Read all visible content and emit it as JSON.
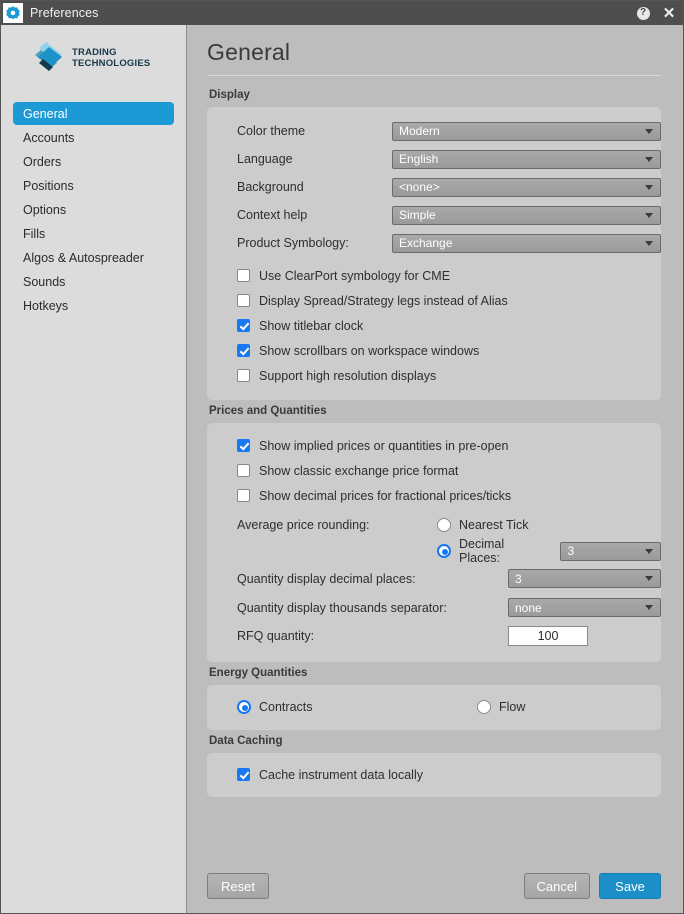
{
  "titlebar": {
    "title": "Preferences",
    "app_icon": "gear-icon",
    "help_label": "?",
    "close_label": "✕"
  },
  "sidebar": {
    "logo": {
      "line1": "TRADING",
      "line2": "TECHNOLOGIES",
      "colors": [
        "#8ed4e8",
        "#4a9fb5",
        "#1c77a8",
        "#123a4d"
      ]
    },
    "items": [
      {
        "label": "General",
        "selected": true
      },
      {
        "label": "Accounts",
        "selected": false
      },
      {
        "label": "Orders",
        "selected": false
      },
      {
        "label": "Positions",
        "selected": false
      },
      {
        "label": "Options",
        "selected": false
      },
      {
        "label": "Fills",
        "selected": false
      },
      {
        "label": "Algos & Autospreader",
        "selected": false
      },
      {
        "label": "Sounds",
        "selected": false
      },
      {
        "label": "Hotkeys",
        "selected": false
      }
    ]
  },
  "main": {
    "page_title": "General",
    "display": {
      "header": "Display",
      "fields": [
        {
          "label": "Color theme",
          "value": "Modern"
        },
        {
          "label": "Language",
          "value": "English"
        },
        {
          "label": "Background",
          "value": "<none>"
        },
        {
          "label": "Context help",
          "value": "Simple"
        },
        {
          "label": "Product Symbology:",
          "value": "Exchange"
        }
      ],
      "checkboxes": [
        {
          "label": "Use ClearPort symbology for CME",
          "checked": false
        },
        {
          "label": "Display Spread/Strategy legs instead of Alias",
          "checked": false
        },
        {
          "label": "Show titlebar clock",
          "checked": true
        },
        {
          "label": "Show scrollbars on workspace windows",
          "checked": true
        },
        {
          "label": "Support high resolution displays",
          "checked": false
        }
      ]
    },
    "prices_quantities": {
      "header": "Prices and Quantities",
      "checkboxes": [
        {
          "label": "Show implied prices or quantities in pre-open",
          "checked": true
        },
        {
          "label": "Show classic exchange price format",
          "checked": false
        },
        {
          "label": "Show decimal prices for fractional prices/ticks",
          "checked": false
        }
      ],
      "average_price_rounding": {
        "label": "Average price rounding:",
        "nearest_tick_label": "Nearest Tick",
        "nearest_tick_selected": false,
        "decimal_places_label": "Decimal Places:",
        "decimal_places_selected": true,
        "decimal_places_value": "3"
      },
      "qty_decimal_places": {
        "label": "Quantity display decimal places:",
        "value": "3"
      },
      "qty_thousands_sep": {
        "label": "Quantity display thousands separator:",
        "value": "none"
      },
      "rfq_quantity": {
        "label": "RFQ quantity:",
        "value": "100"
      }
    },
    "energy_quantities": {
      "header": "Energy Quantities",
      "options": [
        {
          "label": "Contracts",
          "selected": true
        },
        {
          "label": "Flow",
          "selected": false
        }
      ]
    },
    "data_caching": {
      "header": "Data Caching",
      "checkboxes": [
        {
          "label": "Cache instrument data locally",
          "checked": true
        }
      ]
    }
  },
  "footer": {
    "reset_label": "Reset",
    "cancel_label": "Cancel",
    "save_label": "Save"
  },
  "colors": {
    "accent_blue": "#1c9ad6",
    "save_blue": "#1c8fc9",
    "control_blue": "#1877f2",
    "window_bg": "#bdbdbd",
    "panel_bg": "#cccccc",
    "sidebar_bg": "#dcdcdc",
    "titlebar_bg": "#4e4e4e"
  }
}
